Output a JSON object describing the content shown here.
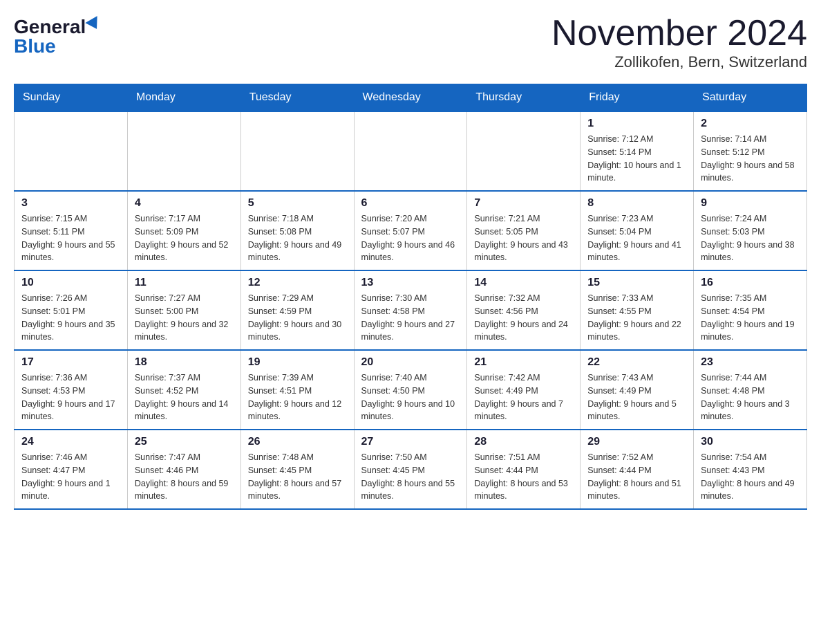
{
  "header": {
    "logo_general": "General",
    "logo_blue": "Blue",
    "title": "November 2024",
    "subtitle": "Zollikofen, Bern, Switzerland"
  },
  "days_of_week": [
    "Sunday",
    "Monday",
    "Tuesday",
    "Wednesday",
    "Thursday",
    "Friday",
    "Saturday"
  ],
  "weeks": [
    {
      "days": [
        {
          "number": "",
          "info": "",
          "empty": true
        },
        {
          "number": "",
          "info": "",
          "empty": true
        },
        {
          "number": "",
          "info": "",
          "empty": true
        },
        {
          "number": "",
          "info": "",
          "empty": true
        },
        {
          "number": "",
          "info": "",
          "empty": true
        },
        {
          "number": "1",
          "info": "Sunrise: 7:12 AM\nSunset: 5:14 PM\nDaylight: 10 hours and 1 minute."
        },
        {
          "number": "2",
          "info": "Sunrise: 7:14 AM\nSunset: 5:12 PM\nDaylight: 9 hours and 58 minutes."
        }
      ]
    },
    {
      "days": [
        {
          "number": "3",
          "info": "Sunrise: 7:15 AM\nSunset: 5:11 PM\nDaylight: 9 hours and 55 minutes."
        },
        {
          "number": "4",
          "info": "Sunrise: 7:17 AM\nSunset: 5:09 PM\nDaylight: 9 hours and 52 minutes."
        },
        {
          "number": "5",
          "info": "Sunrise: 7:18 AM\nSunset: 5:08 PM\nDaylight: 9 hours and 49 minutes."
        },
        {
          "number": "6",
          "info": "Sunrise: 7:20 AM\nSunset: 5:07 PM\nDaylight: 9 hours and 46 minutes."
        },
        {
          "number": "7",
          "info": "Sunrise: 7:21 AM\nSunset: 5:05 PM\nDaylight: 9 hours and 43 minutes."
        },
        {
          "number": "8",
          "info": "Sunrise: 7:23 AM\nSunset: 5:04 PM\nDaylight: 9 hours and 41 minutes."
        },
        {
          "number": "9",
          "info": "Sunrise: 7:24 AM\nSunset: 5:03 PM\nDaylight: 9 hours and 38 minutes."
        }
      ]
    },
    {
      "days": [
        {
          "number": "10",
          "info": "Sunrise: 7:26 AM\nSunset: 5:01 PM\nDaylight: 9 hours and 35 minutes."
        },
        {
          "number": "11",
          "info": "Sunrise: 7:27 AM\nSunset: 5:00 PM\nDaylight: 9 hours and 32 minutes."
        },
        {
          "number": "12",
          "info": "Sunrise: 7:29 AM\nSunset: 4:59 PM\nDaylight: 9 hours and 30 minutes."
        },
        {
          "number": "13",
          "info": "Sunrise: 7:30 AM\nSunset: 4:58 PM\nDaylight: 9 hours and 27 minutes."
        },
        {
          "number": "14",
          "info": "Sunrise: 7:32 AM\nSunset: 4:56 PM\nDaylight: 9 hours and 24 minutes."
        },
        {
          "number": "15",
          "info": "Sunrise: 7:33 AM\nSunset: 4:55 PM\nDaylight: 9 hours and 22 minutes."
        },
        {
          "number": "16",
          "info": "Sunrise: 7:35 AM\nSunset: 4:54 PM\nDaylight: 9 hours and 19 minutes."
        }
      ]
    },
    {
      "days": [
        {
          "number": "17",
          "info": "Sunrise: 7:36 AM\nSunset: 4:53 PM\nDaylight: 9 hours and 17 minutes."
        },
        {
          "number": "18",
          "info": "Sunrise: 7:37 AM\nSunset: 4:52 PM\nDaylight: 9 hours and 14 minutes."
        },
        {
          "number": "19",
          "info": "Sunrise: 7:39 AM\nSunset: 4:51 PM\nDaylight: 9 hours and 12 minutes."
        },
        {
          "number": "20",
          "info": "Sunrise: 7:40 AM\nSunset: 4:50 PM\nDaylight: 9 hours and 10 minutes."
        },
        {
          "number": "21",
          "info": "Sunrise: 7:42 AM\nSunset: 4:49 PM\nDaylight: 9 hours and 7 minutes."
        },
        {
          "number": "22",
          "info": "Sunrise: 7:43 AM\nSunset: 4:49 PM\nDaylight: 9 hours and 5 minutes."
        },
        {
          "number": "23",
          "info": "Sunrise: 7:44 AM\nSunset: 4:48 PM\nDaylight: 9 hours and 3 minutes."
        }
      ]
    },
    {
      "days": [
        {
          "number": "24",
          "info": "Sunrise: 7:46 AM\nSunset: 4:47 PM\nDaylight: 9 hours and 1 minute."
        },
        {
          "number": "25",
          "info": "Sunrise: 7:47 AM\nSunset: 4:46 PM\nDaylight: 8 hours and 59 minutes."
        },
        {
          "number": "26",
          "info": "Sunrise: 7:48 AM\nSunset: 4:45 PM\nDaylight: 8 hours and 57 minutes."
        },
        {
          "number": "27",
          "info": "Sunrise: 7:50 AM\nSunset: 4:45 PM\nDaylight: 8 hours and 55 minutes."
        },
        {
          "number": "28",
          "info": "Sunrise: 7:51 AM\nSunset: 4:44 PM\nDaylight: 8 hours and 53 minutes."
        },
        {
          "number": "29",
          "info": "Sunrise: 7:52 AM\nSunset: 4:44 PM\nDaylight: 8 hours and 51 minutes."
        },
        {
          "number": "30",
          "info": "Sunrise: 7:54 AM\nSunset: 4:43 PM\nDaylight: 8 hours and 49 minutes."
        }
      ]
    }
  ]
}
